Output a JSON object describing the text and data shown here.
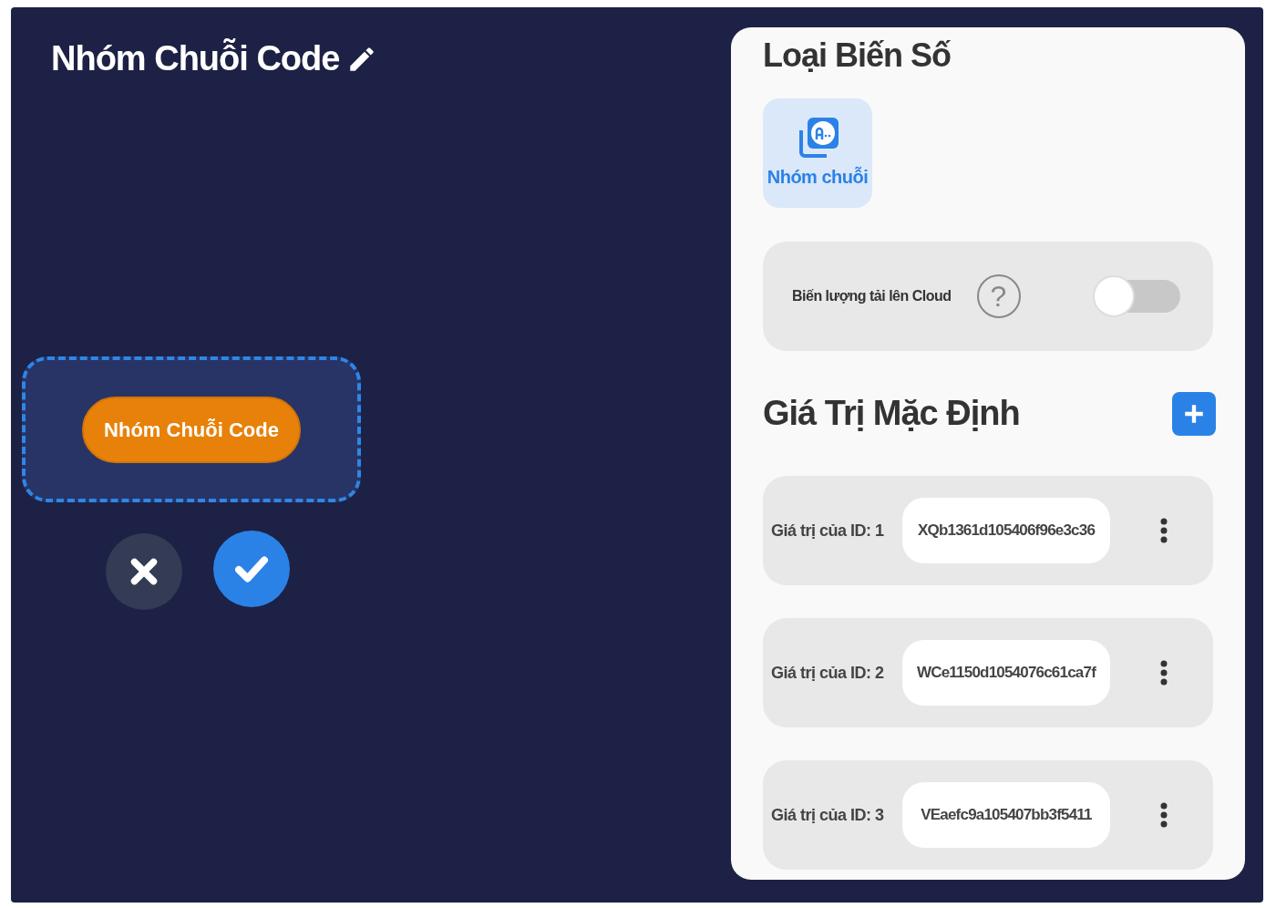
{
  "title": "Nhóm Chuỗi Code",
  "preview": {
    "chip": "Nhóm Chuỗi Code"
  },
  "variable_type": {
    "heading": "Loại Biến Số",
    "options": [
      {
        "label": "Nhóm chuỗi",
        "selected": true
      }
    ]
  },
  "cloud": {
    "label": "Biến lượng tải lên Cloud",
    "help": "?",
    "on": false
  },
  "defaults": {
    "heading": "Giá Trị Mặc Định",
    "items": [
      {
        "label": "Giá trị của ID: 1",
        "value": "XQb1361d105406f96e3c36"
      },
      {
        "label": "Giá trị của ID: 2",
        "value": "WCe1150d1054076c61ca7f"
      },
      {
        "label": "Giá trị của ID: 3",
        "value": "VEaefc9a105407bb3f5411"
      }
    ]
  }
}
